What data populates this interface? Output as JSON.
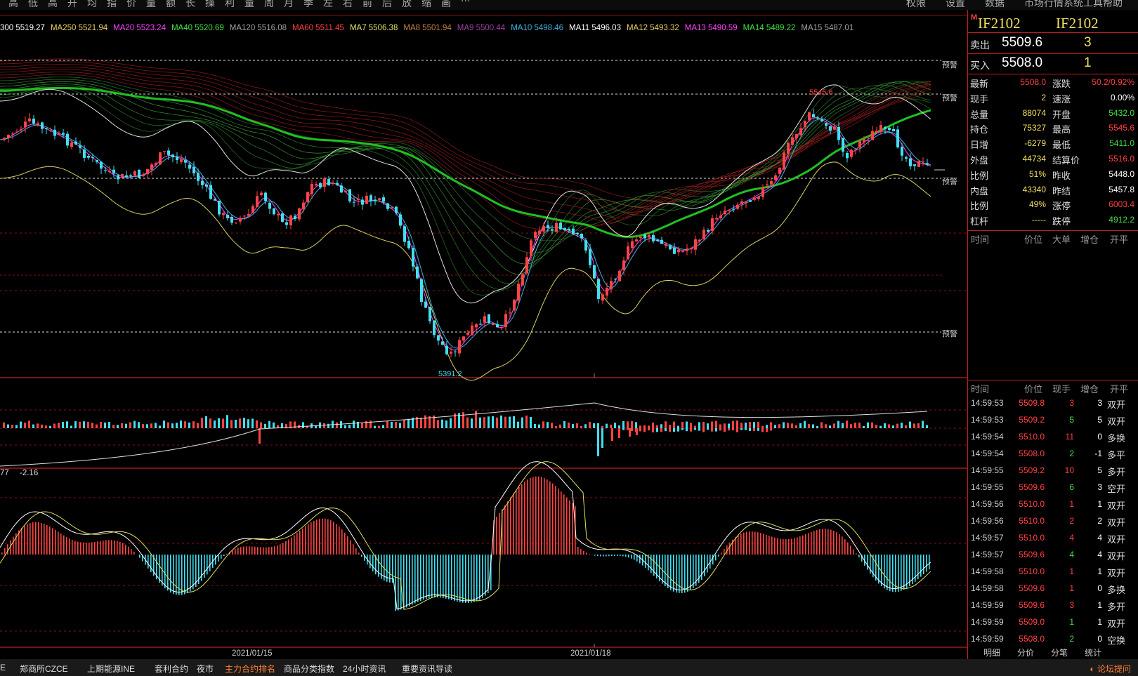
{
  "toolbar": {
    "items": [
      "高",
      "低",
      "高",
      "开",
      "均",
      "指",
      "价",
      "量",
      "额",
      "长",
      "操",
      "利",
      "量",
      "周",
      "月",
      "季",
      "左",
      "右",
      "前",
      "后",
      "放",
      "缩",
      "画",
      "···"
    ],
    "right_items": [
      "权限",
      "设置",
      "数据",
      "市场行情",
      "系统工具",
      "帮助"
    ]
  },
  "ma_legend": [
    {
      "label": "300 5519.27",
      "color": "#ffffff"
    },
    {
      "label": "MA250 5521.94",
      "color": "#e8d060"
    },
    {
      "label": "MA20 5523.24",
      "color": "#ff40ff"
    },
    {
      "label": "MA40 5520.69",
      "color": "#40e040"
    },
    {
      "label": "MA120 5516.08",
      "color": "#a0a0a0"
    },
    {
      "label": "MA60 5511.45",
      "color": "#ff4040"
    },
    {
      "label": "MA7 5506.38",
      "color": "#e0e060"
    },
    {
      "label": "MA8 5501.94",
      "color": "#c08040"
    },
    {
      "label": "MA9 5500.44",
      "color": "#a040a0"
    },
    {
      "label": "MA10 5498.46",
      "color": "#40b0e0"
    },
    {
      "label": "MA11 5496.03",
      "color": "#ffffff"
    },
    {
      "label": "MA12 5493.32",
      "color": "#e8d060"
    },
    {
      "label": "MA13 5490.59",
      "color": "#ff40ff"
    },
    {
      "label": "MA14 5489.22",
      "color": "#40e040"
    },
    {
      "label": "MA15 5487.01",
      "color": "#a0a0a0"
    }
  ],
  "alert_label": "预警",
  "price_high_note": "5545.6",
  "price_low_note": "5391.2",
  "macd_legend": [
    "77",
    "-2.16"
  ],
  "dates": [
    "2021/01/15",
    "2021/01/18"
  ],
  "colors": {
    "up": "#ff4444",
    "down": "#40e0f0",
    "grid": "#8b1010",
    "accent": "#c02020"
  },
  "chart_data": {
    "type": "candlestick",
    "title": "IF2102",
    "ylim": [
      5380,
      5560
    ],
    "high": 5545.6,
    "low": 5391.2,
    "x": [
      "2021/01/15",
      "2021/01/18"
    ],
    "series": [
      {
        "name": "MA250",
        "values": [
          5521.94
        ]
      },
      {
        "name": "MA20",
        "values": [
          5523.24
        ]
      },
      {
        "name": "MA40",
        "values": [
          5520.69
        ]
      },
      {
        "name": "MA120",
        "values": [
          5516.08
        ]
      },
      {
        "name": "MA60",
        "values": [
          5511.45
        ]
      }
    ]
  },
  "quote": {
    "marker": "M",
    "code1": "IF2102",
    "code2": "IF2102",
    "sell": {
      "label": "卖出",
      "price": "5509.6",
      "qty": "3"
    },
    "buy": {
      "label": "买入",
      "price": "5508.0",
      "qty": "1"
    },
    "stats": [
      {
        "l1": "最新",
        "v1": "5508.0",
        "c1": "#ff4040",
        "l2": "涨跌",
        "v2": "50.2/0.92%",
        "c2": "#ff4040"
      },
      {
        "l1": "现手",
        "v1": "2",
        "c1": "#f0e060",
        "l2": "速涨",
        "v2": "0.00%",
        "c2": "#ffffff"
      },
      {
        "l1": "总量",
        "v1": "88074",
        "c1": "#f0e060",
        "l2": "开盘",
        "v2": "5432.0",
        "c2": "#40e040"
      },
      {
        "l1": "持仓",
        "v1": "75327",
        "c1": "#f0e060",
        "l2": "最高",
        "v2": "5545.6",
        "c2": "#ff4040"
      },
      {
        "l1": "日增",
        "v1": "-6279",
        "c1": "#f0e060",
        "l2": "最低",
        "v2": "5411.0",
        "c2": "#40e040"
      },
      {
        "l1": "外盘",
        "v1": "44734",
        "c1": "#f0e060",
        "l2": "结算价",
        "v2": "5516.0",
        "c2": "#ff4040"
      },
      {
        "l1": "比例",
        "v1": "51%",
        "c1": "#f0e060",
        "l2": "昨收",
        "v2": "5448.0",
        "c2": "#ffffff"
      },
      {
        "l1": "内盘",
        "v1": "43340",
        "c1": "#f0e060",
        "l2": "昨结",
        "v2": "5457.8",
        "c2": "#ffffff"
      },
      {
        "l1": "比例",
        "v1": "49%",
        "c1": "#f0e060",
        "l2": "涨停",
        "v2": "6003.4",
        "c2": "#ff4040"
      },
      {
        "l1": "杠杆",
        "v1": "-----",
        "c1": "#f0e060",
        "l2": "跌停",
        "v2": "4912.2",
        "c2": "#40e040"
      }
    ],
    "header1": [
      "时间",
      "价位",
      "大单",
      "增仓",
      "开平"
    ],
    "header2": [
      "时间",
      "价位",
      "现手",
      "增仓",
      "开平"
    ],
    "trades": [
      {
        "time": "14:59:53",
        "price": "5509.8",
        "vol": "3",
        "vc": "#ff4040",
        "inc": "3",
        "type": "双开"
      },
      {
        "time": "14:59:53",
        "price": "5509.2",
        "vol": "5",
        "vc": "#40e040",
        "inc": "5",
        "type": "双开"
      },
      {
        "time": "14:59:54",
        "price": "5510.0",
        "vol": "11",
        "vc": "#ff4040",
        "inc": "0",
        "type": "多换"
      },
      {
        "time": "14:59:54",
        "price": "5508.0",
        "vol": "2",
        "vc": "#40e040",
        "inc": "-1",
        "type": "多平"
      },
      {
        "time": "14:59:55",
        "price": "5509.2",
        "vol": "10",
        "vc": "#ff4040",
        "inc": "5",
        "type": "多开"
      },
      {
        "time": "14:59:55",
        "price": "5509.6",
        "vol": "6",
        "vc": "#40e040",
        "inc": "3",
        "type": "空开"
      },
      {
        "time": "14:59:56",
        "price": "5510.0",
        "vol": "1",
        "vc": "#ff4040",
        "inc": "1",
        "type": "双开"
      },
      {
        "time": "14:59:56",
        "price": "5510.0",
        "vol": "2",
        "vc": "#ff4040",
        "inc": "2",
        "type": "双开"
      },
      {
        "time": "14:59:57",
        "price": "5510.0",
        "vol": "4",
        "vc": "#ff4040",
        "inc": "4",
        "type": "双开"
      },
      {
        "time": "14:59:57",
        "price": "5509.6",
        "vol": "4",
        "vc": "#40e040",
        "inc": "4",
        "type": "双开"
      },
      {
        "time": "14:59:58",
        "price": "5510.0",
        "vol": "1",
        "vc": "#ff4040",
        "inc": "1",
        "type": "双开"
      },
      {
        "time": "14:59:58",
        "price": "5509.6",
        "vol": "1",
        "vc": "#ff4040",
        "inc": "0",
        "type": "多换"
      },
      {
        "time": "14:59:59",
        "price": "5509.6",
        "vol": "3",
        "vc": "#ff4040",
        "inc": "1",
        "type": "多开"
      },
      {
        "time": "14:59:59",
        "price": "5509.0",
        "vol": "1",
        "vc": "#40e040",
        "inc": "1",
        "type": "双开"
      },
      {
        "time": "14:59:59",
        "price": "5508.0",
        "vol": "2",
        "vc": "#40e040",
        "inc": "0",
        "type": "空换"
      }
    ],
    "tabs": [
      "明细",
      "分价",
      "分笔",
      "统计"
    ]
  },
  "statusbar": {
    "items": [
      "E",
      "郑商所CZCE",
      "上期能源INE",
      "套利合约",
      "夜市",
      "主力合约排名",
      "商品分类指数",
      "24小时资讯",
      "重要资讯导读"
    ],
    "active_index": 5,
    "help": "论坛提问"
  }
}
